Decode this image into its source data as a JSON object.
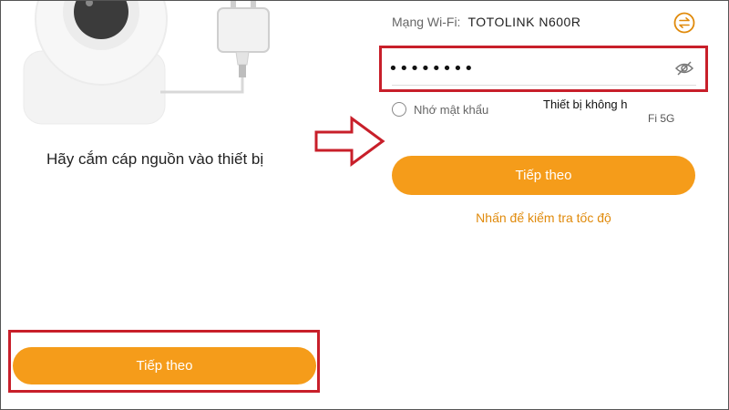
{
  "left": {
    "instruction": "Hãy cắm cáp nguồn vào thiết bị",
    "next_button": "Tiếp theo"
  },
  "right": {
    "wifi_label": "Mạng Wi-Fi:",
    "wifi_name": "TOTOLINK N600R",
    "password_value": "••••••••",
    "remember_label": "Nhớ mật khẩu",
    "tooltip_line1": "Thiết bị không h",
    "tooltip_line2": "Fi 5G",
    "next_button": "Tiếp theo",
    "speed_link": "Nhấn để kiểm tra tốc độ"
  },
  "colors": {
    "accent": "#f59c1a",
    "highlight": "#c81f2a",
    "link": "#e08a0b"
  },
  "icons": {
    "switch": "swap-icon",
    "eye": "eye-hidden-icon",
    "arrow": "right-arrow-icon"
  }
}
